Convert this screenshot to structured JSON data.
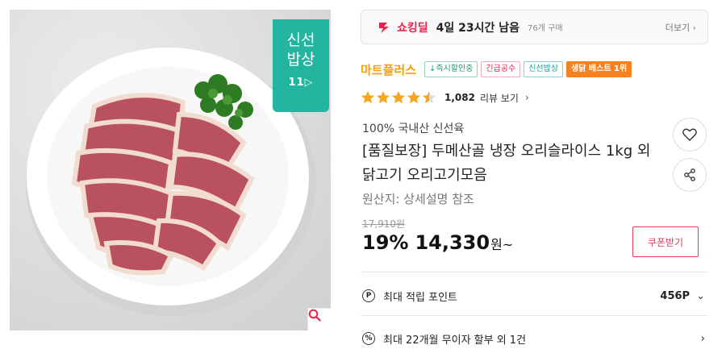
{
  "image": {
    "badge": {
      "line1": "신선",
      "line2": "밥상",
      "line3": "11▷"
    },
    "zoom_icon": "search-icon"
  },
  "deal": {
    "brand": "쇼킹딜",
    "time_left": "4일 23시간 남음",
    "buyers": "76개 구매",
    "more": "더보기"
  },
  "seller": {
    "name": "마트플러스",
    "tags": [
      {
        "label": "↓즉시할인중",
        "style": "green"
      },
      {
        "label": "긴급공수",
        "style": "red"
      },
      {
        "label": "신선밥상",
        "style": "teal"
      },
      {
        "label": "생닭 베스트 1위",
        "style": "orange"
      }
    ]
  },
  "rating": {
    "stars": 4.5,
    "count": "1,082",
    "link": "리뷰 보기",
    "color": "#f5a623"
  },
  "product": {
    "subtitle": "100% 국내산 신선육",
    "title": "[품질보장] 두메산골 냉장 오리슬라이스 1kg 외 닭고기 오리고기모음",
    "origin": "원산지: 상세설명 참조"
  },
  "price": {
    "original": "17,910원",
    "discount": "19%",
    "current": "14,330",
    "unit": "원~",
    "coupon_label": "쿠폰받기"
  },
  "points": {
    "icon": "P",
    "label": "최대 적립 포인트",
    "value": "456P"
  },
  "installment": {
    "icon": "%",
    "label": "최대 22개월 무이자 할부 외 1건"
  },
  "colors": {
    "accent": "#e8224a",
    "seller": "#f5a100",
    "badge": "#23b5a0"
  }
}
